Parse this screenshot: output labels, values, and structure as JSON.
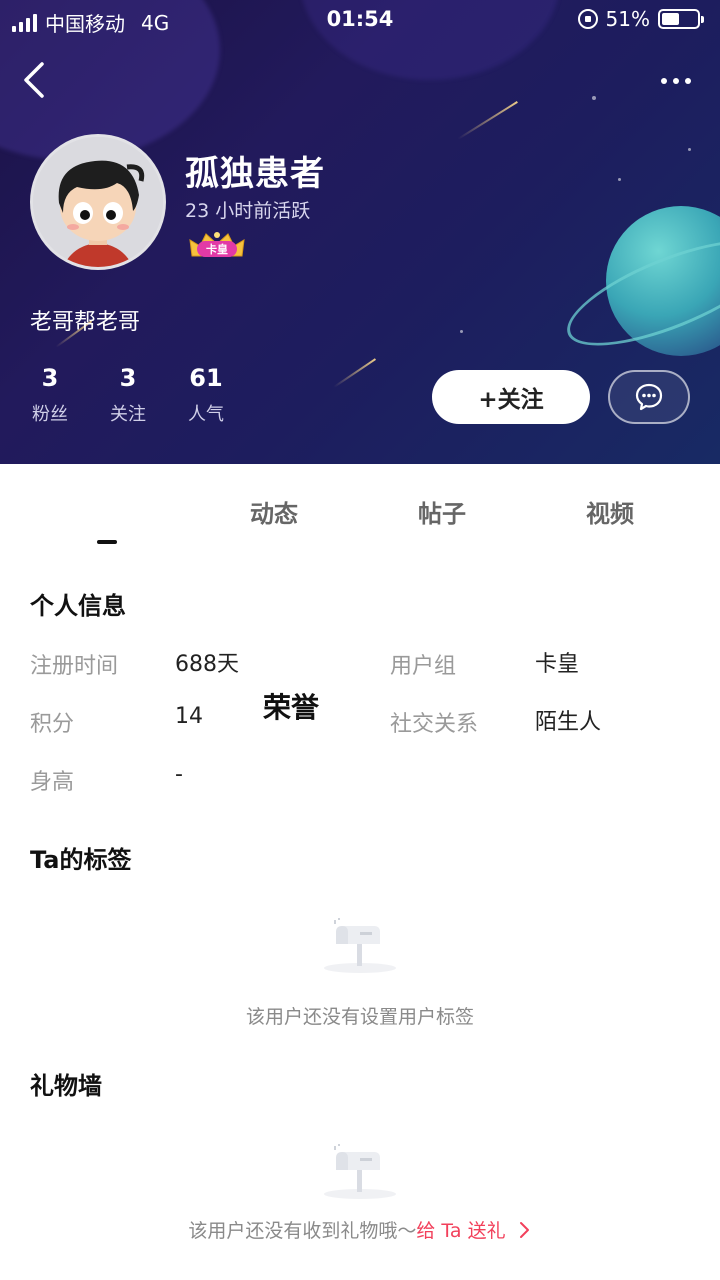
{
  "status_bar": {
    "carrier": "中国移动",
    "network": "4G",
    "time": "01:54",
    "battery_percent": "51%",
    "battery_level": 0.51
  },
  "profile": {
    "name": "孤独患者",
    "active_status": "23 小时前活跃",
    "badge_label": "卡皇",
    "bio": "老哥帮老哥",
    "stats": [
      {
        "value": "3",
        "label": "粉丝"
      },
      {
        "value": "3",
        "label": "关注"
      },
      {
        "value": "61",
        "label": "人气"
      }
    ],
    "follow_label": "+关注"
  },
  "tabs": [
    {
      "label": "荣誉",
      "active": true
    },
    {
      "label": "动态",
      "active": false
    },
    {
      "label": "帖子",
      "active": false
    },
    {
      "label": "视频",
      "active": false
    }
  ],
  "personal_info": {
    "title": "个人信息",
    "register_label": "注册时间",
    "register_value": "688天",
    "group_label": "用户组",
    "group_value": "卡皇",
    "points_label": "积分",
    "points_value": "14",
    "relation_label": "社交关系",
    "relation_value": "陌生人",
    "height_label": "身高",
    "height_value": "-"
  },
  "tags": {
    "title": "Ta的标签",
    "empty_text": "该用户还没有设置用户标签"
  },
  "gifts": {
    "title": "礼物墙",
    "empty_text": "该用户还没有收到礼物哦～",
    "send_link": "给 Ta 送礼"
  },
  "colors": {
    "accent_red": "#f2405b",
    "hero_bg": "#1d1a5c"
  }
}
